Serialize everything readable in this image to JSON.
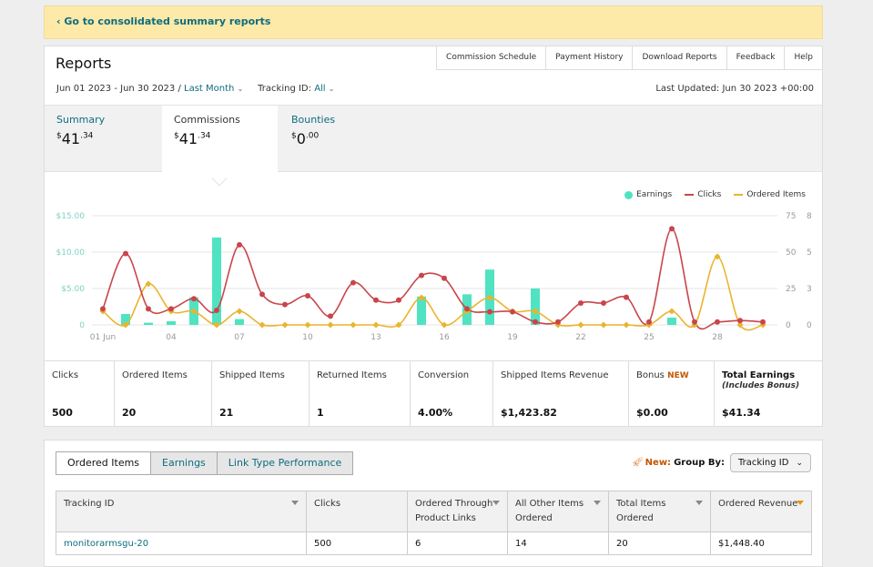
{
  "banner": {
    "link": "‹ Go to consolidated summary reports"
  },
  "header": {
    "title": "Reports",
    "buttons": [
      "Commission Schedule",
      "Payment History",
      "Download Reports",
      "Feedback",
      "Help"
    ],
    "date_range": "Jun 01 2023 - Jun 30 2023 /",
    "period": "Last Month",
    "tracking_label": "Tracking ID:",
    "tracking_value": "All",
    "last_updated": "Last Updated: Jun 30 2023 +00:00"
  },
  "tabs": [
    {
      "label": "Summary",
      "dollar": "$",
      "whole": "41",
      "cents": ".34"
    },
    {
      "label": "Commissions",
      "dollar": "$",
      "whole": "41",
      "cents": ".34"
    },
    {
      "label": "Bounties",
      "dollar": "$",
      "whole": "0",
      "cents": ".00"
    }
  ],
  "chart_data": {
    "type": "bar+line",
    "legend": [
      "Earnings",
      "Clicks",
      "Ordered Items"
    ],
    "colors": {
      "earnings": "#50e3c2",
      "clicks": "#c9454a",
      "ordered": "#eab42e"
    },
    "x_ticks": [
      "01 Jun",
      "04",
      "07",
      "10",
      "13",
      "16",
      "19",
      "22",
      "25",
      "28"
    ],
    "y_left_ticks": [
      "$15.00",
      "$10.00",
      "$5.00",
      "0"
    ],
    "y_mid_ticks": [
      "75",
      "50",
      "25",
      "0"
    ],
    "y_right_ticks": [
      "8",
      "5",
      "3",
      "0"
    ],
    "ylim_left": [
      0,
      15
    ],
    "ylim_clicks": [
      0,
      75
    ],
    "ylim_ordered": [
      0,
      8
    ],
    "days": [
      1,
      2,
      3,
      4,
      5,
      6,
      7,
      8,
      9,
      10,
      11,
      12,
      13,
      14,
      15,
      16,
      17,
      18,
      19,
      20,
      21,
      22,
      23,
      24,
      25,
      26,
      27,
      28,
      29,
      30
    ],
    "earnings": [
      0,
      1.5,
      0.3,
      0.5,
      3.8,
      12,
      0.8,
      0,
      0,
      0,
      0,
      0,
      0,
      0,
      3.9,
      0,
      4.2,
      7.6,
      0,
      5,
      0,
      0,
      0,
      0,
      0,
      1,
      0,
      0,
      0,
      0
    ],
    "clicks": [
      11,
      49,
      11,
      11,
      18,
      10,
      55,
      21,
      14,
      20,
      6,
      29,
      17,
      17,
      34,
      32,
      11,
      9,
      9,
      2,
      2,
      15,
      15,
      19,
      2,
      66,
      2,
      2,
      3,
      2
    ],
    "ordered": [
      1,
      0,
      3,
      1,
      1,
      0,
      1,
      0,
      0,
      0,
      0,
      0,
      0,
      0,
      2,
      0,
      1,
      2,
      1,
      1,
      0,
      0,
      0,
      0,
      0,
      1,
      0,
      5,
      0,
      0
    ]
  },
  "metrics": [
    {
      "label": "Clicks",
      "value": "500"
    },
    {
      "label": "Ordered Items",
      "value": "20"
    },
    {
      "label": "Shipped Items",
      "value": "21"
    },
    {
      "label": "Returned Items",
      "value": "1"
    },
    {
      "label": "Conversion",
      "value": "4.00%"
    },
    {
      "label": "Shipped Items Revenue",
      "value": "$1,423.82"
    },
    {
      "label": "Bonus",
      "badge": "NEW",
      "value": "$0.00"
    },
    {
      "label": "Total Earnings",
      "sub": "(Includes Bonus)",
      "value": "$41.34"
    }
  ],
  "subtabs": [
    "Ordered Items",
    "Earnings",
    "Link Type Performance"
  ],
  "groupby": {
    "new": "New:",
    "label": "Group By:",
    "value": "Tracking ID"
  },
  "table": {
    "headers": [
      "Tracking ID",
      "Clicks",
      "Ordered Through Product Links",
      "All Other Items Ordered",
      "Total Items Ordered",
      "Ordered Revenue"
    ],
    "rows": [
      [
        "monitorarmsgu-20",
        "500",
        "6",
        "14",
        "20",
        "$1,448.40"
      ]
    ]
  }
}
